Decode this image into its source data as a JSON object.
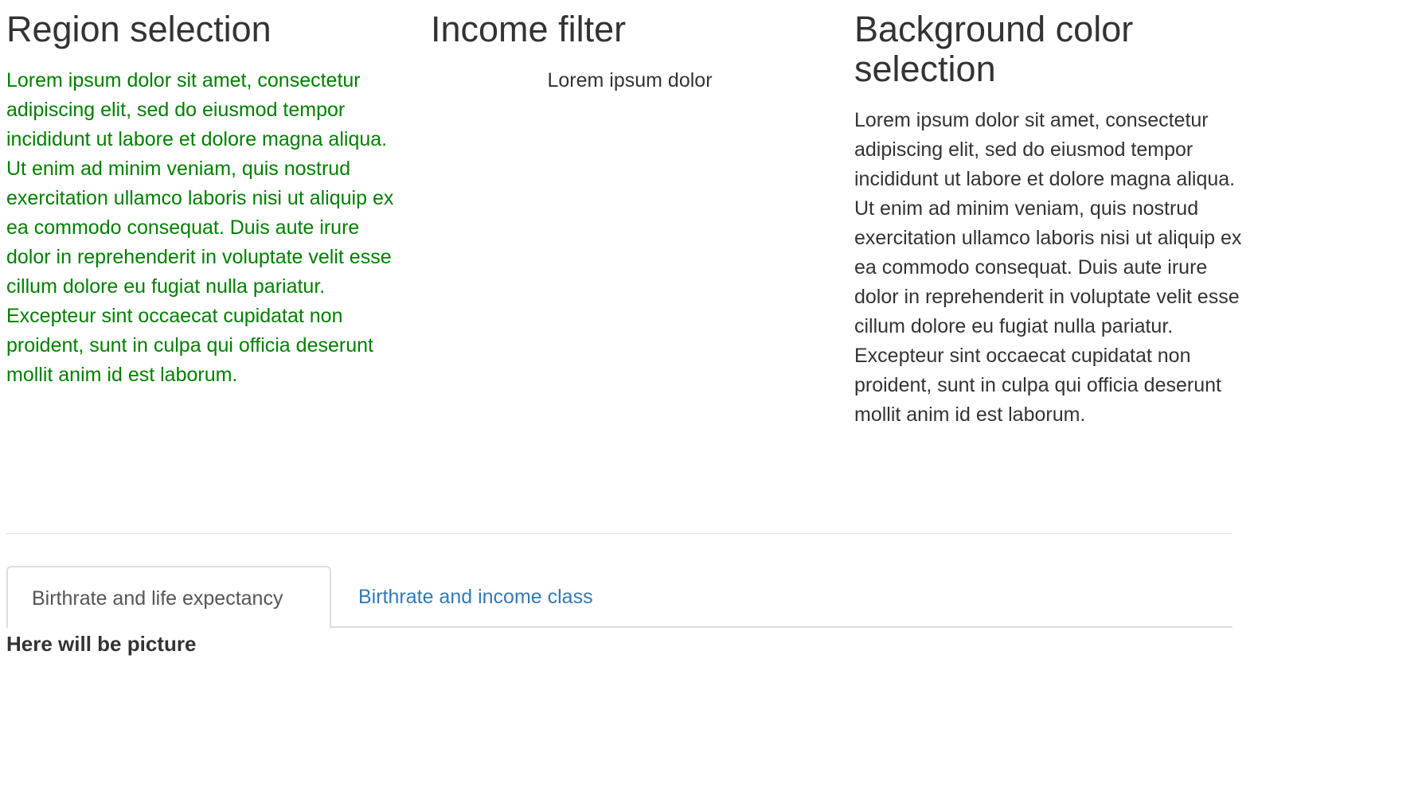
{
  "columns": {
    "region": {
      "title": "Region selection",
      "text": "Lorem ipsum dolor sit amet, consectetur adipiscing elit, sed do eiusmod tempor incididunt ut labore et dolore magna aliqua. Ut enim ad minim veniam, quis nostrud exercitation ullamco laboris nisi ut aliquip ex ea commodo consequat. Duis aute irure dolor in reprehenderit in voluptate velit esse cillum dolore eu fugiat nulla pariatur. Excepteur sint occaecat cupidatat non proident, sunt in culpa qui officia deserunt mollit anim id est laborum.",
      "text_color": "#008000"
    },
    "income": {
      "title": "Income filter",
      "text": "Lorem ipsum dolor"
    },
    "background": {
      "title": "Background color selection",
      "text": "Lorem ipsum dolor sit amet, consectetur adipiscing elit, sed do eiusmod tempor incididunt ut labore et dolore magna aliqua. Ut enim ad minim veniam, quis nostrud exercitation ullamco laboris nisi ut aliquip ex ea commodo consequat. Duis aute irure dolor in reprehenderit in voluptate velit esse cillum dolore eu fugiat nulla pariatur. Excepteur sint occaecat cupidatat non proident, sunt in culpa qui officia deserunt mollit anim id est laborum."
    }
  },
  "tabs": [
    {
      "label": "Birthrate and life expectancy",
      "active": true
    },
    {
      "label": "Birthrate and income class",
      "active": false
    }
  ],
  "tab_content": {
    "note": "Here will be picture"
  },
  "colors": {
    "link": "#337ab7",
    "heading": "#333333",
    "green_text": "#008000",
    "border": "#dddddd"
  }
}
